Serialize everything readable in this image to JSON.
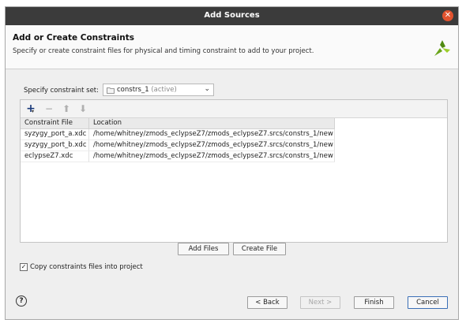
{
  "window": {
    "title": "Add Sources"
  },
  "header": {
    "title": "Add or Create Constraints",
    "subtitle": "Specify or create constraint files for physical and timing constraint to add to your project."
  },
  "constraint_set": {
    "label": "Specify constraint set:",
    "value": "constrs_1",
    "suffix": "(active)"
  },
  "table": {
    "columns": [
      "Constraint File",
      "Location"
    ],
    "rows": [
      {
        "file": "syzygy_port_a.xdc",
        "location": "/home/whitney/zmods_eclypseZ7/zmods_eclypseZ7.srcs/constrs_1/new"
      },
      {
        "file": "syzygy_port_b.xdc",
        "location": "/home/whitney/zmods_eclypseZ7/zmods_eclypseZ7.srcs/constrs_1/new"
      },
      {
        "file": "eclypseZ7.xdc",
        "location": "/home/whitney/zmods_eclypseZ7/zmods_eclypseZ7.srcs/constrs_1/new"
      }
    ]
  },
  "buttons": {
    "add_files": "Add Files",
    "create_file": "Create File",
    "back": "< Back",
    "next": "Next >",
    "finish": "Finish",
    "cancel": "Cancel"
  },
  "copy_option": {
    "label": "Copy constraints files into project",
    "checked": true
  },
  "icons": {
    "close": "close-icon",
    "logo": "vivado-logo-icon",
    "folder": "folder-icon",
    "add": "plus-icon",
    "remove": "minus-icon",
    "up": "arrow-up-icon",
    "down": "arrow-down-icon",
    "help": "help-icon"
  },
  "colors": {
    "titlebar": "#3b3b3b",
    "close": "#e2532f",
    "logo_green": "#7ab51d",
    "primary_border": "#3b6fb6"
  }
}
